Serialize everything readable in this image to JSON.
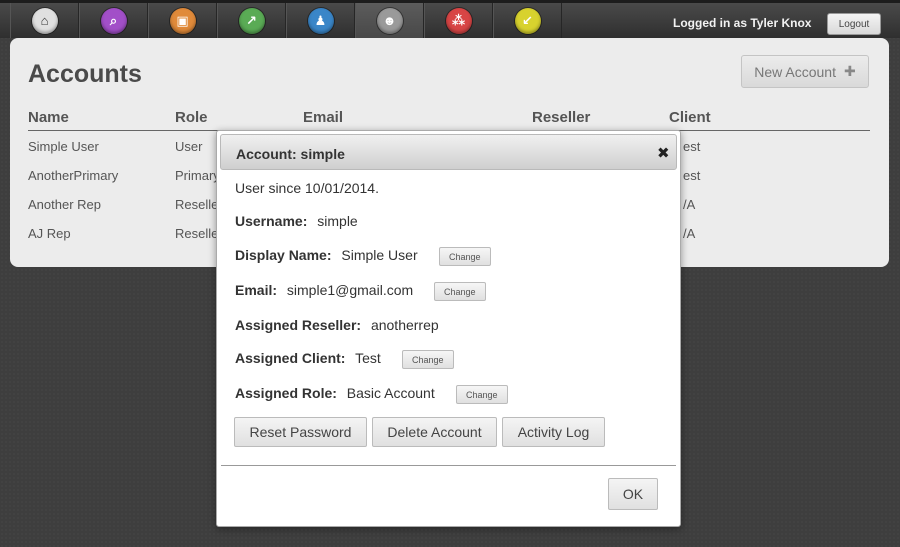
{
  "nav": {
    "items": [
      {
        "icon": "home-icon",
        "glyph": "⌂",
        "color": "#e0e0e0",
        "active": false
      },
      {
        "icon": "search-icon",
        "glyph": "⌕",
        "color": "#a24fc8",
        "active": false
      },
      {
        "icon": "image-icon",
        "glyph": "▣",
        "color": "#e08a3a",
        "active": false
      },
      {
        "icon": "export-icon",
        "glyph": "↗",
        "color": "#5aab55",
        "active": false
      },
      {
        "icon": "user-icon",
        "glyph": "♟",
        "color": "#3a86c8",
        "active": false
      },
      {
        "icon": "accounts-icon",
        "glyph": "☻",
        "color": "#9a9a9a",
        "active": true
      },
      {
        "icon": "group-icon",
        "glyph": "⁂",
        "color": "#d84545",
        "active": false
      },
      {
        "icon": "import-icon",
        "glyph": "↙",
        "color": "#d8d22e",
        "active": false
      }
    ],
    "logged_in_text": "Logged in as Tyler Knox",
    "logout_label": "Logout"
  },
  "accounts": {
    "title": "Accounts",
    "new_account_label": "New Account",
    "new_account_icon": "plus-icon",
    "columns": [
      "Name",
      "Role",
      "Email",
      "Reseller",
      "Client"
    ],
    "rows": [
      {
        "name": "Simple User",
        "role": "User",
        "client": "est"
      },
      {
        "name": "AnotherPrimary",
        "role": "Primary",
        "client": "est"
      },
      {
        "name": "Another Rep",
        "role": "Reselle",
        "client": "/A"
      },
      {
        "name": "AJ Rep",
        "role": "Reselle",
        "client": "/A"
      }
    ]
  },
  "modal": {
    "title": "Account: simple",
    "close_icon": "close-icon",
    "user_since": "User since 10/01/2014.",
    "username_label": "Username:",
    "username_value": "simple",
    "display_name_label": "Display Name:",
    "display_name_value": "Simple User",
    "email_label": "Email:",
    "email_value": "simple1@gmail.com",
    "reseller_label": "Assigned Reseller:",
    "reseller_value": "anotherrep",
    "client_label": "Assigned Client:",
    "client_value": "Test",
    "role_label": "Assigned Role:",
    "role_value": "Basic Account",
    "change_label": "Change",
    "reset_password_label": "Reset Password",
    "delete_account_label": "Delete Account",
    "activity_log_label": "Activity Log",
    "ok_label": "OK"
  }
}
